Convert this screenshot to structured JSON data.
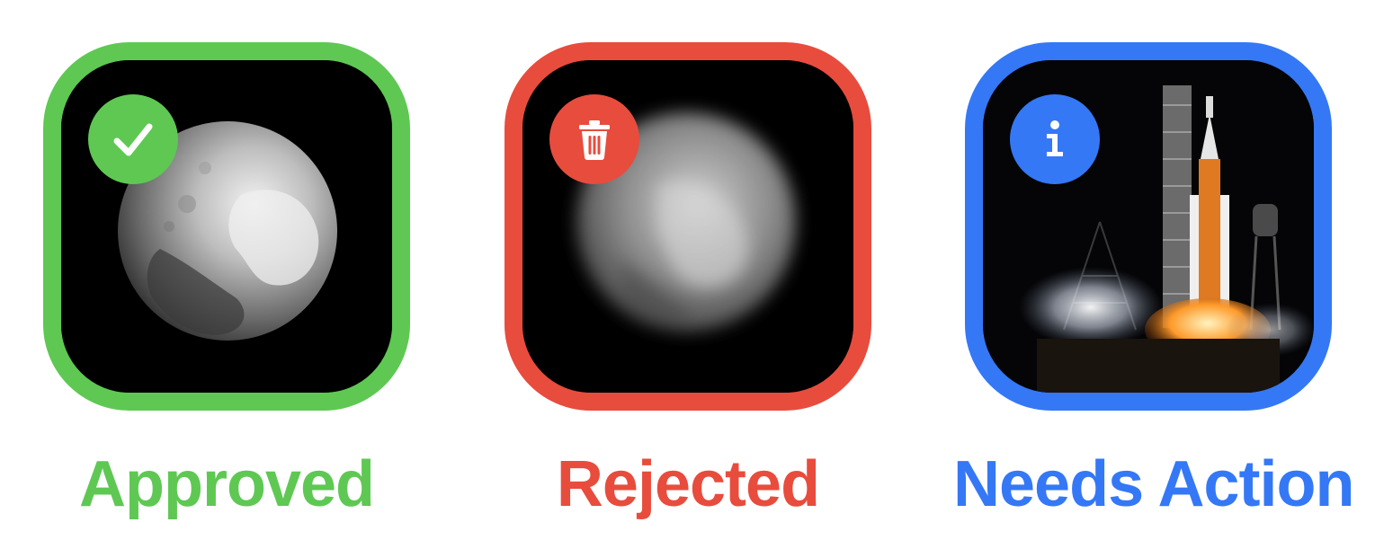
{
  "colors": {
    "approved": "#5ec853",
    "rejected": "#e84c3d",
    "needs_action": "#3478f6"
  },
  "cards": [
    {
      "status": "Approved",
      "badge_icon": "checkmark-icon",
      "image": "sharp-planet-image"
    },
    {
      "status": "Rejected",
      "badge_icon": "trash-icon",
      "image": "blurry-planet-image"
    },
    {
      "status": "Needs Action",
      "badge_icon": "info-icon",
      "image": "rocket-launch-image"
    }
  ]
}
